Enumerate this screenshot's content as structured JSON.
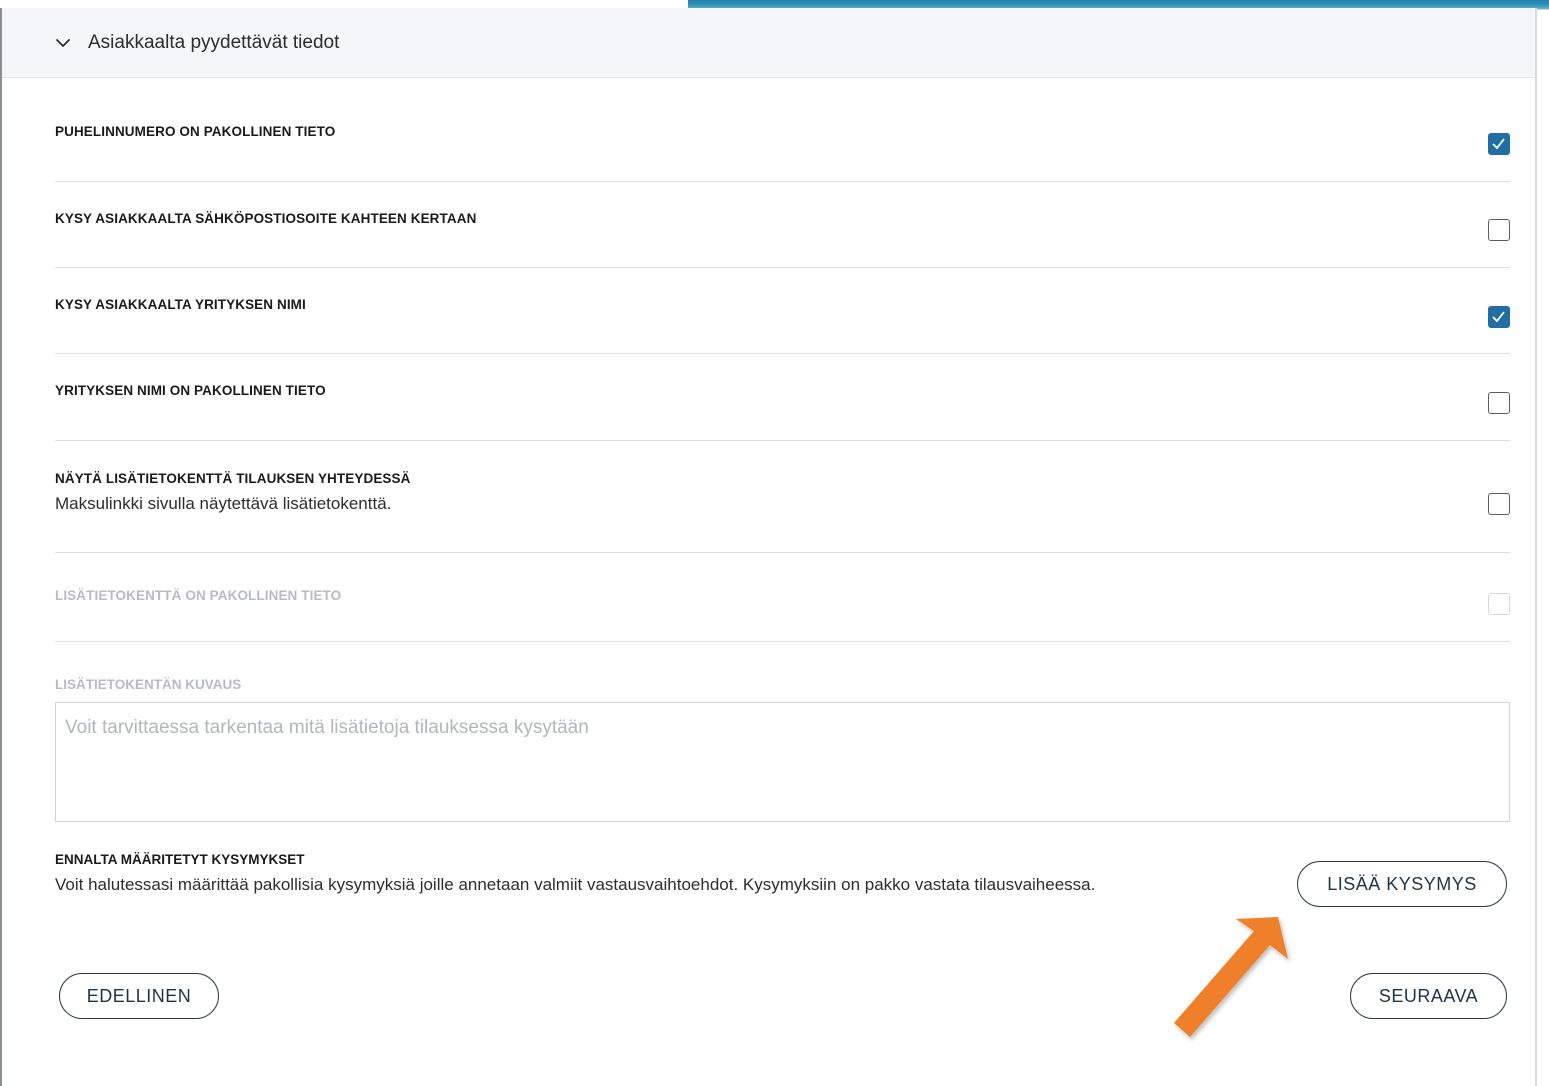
{
  "section": {
    "title": "Asiakkaalta pyydettävät tiedot"
  },
  "settings": [
    {
      "label": "PUHELINNUMERO ON PAKOLLINEN TIETO",
      "description": "",
      "checked": true,
      "disabled": false
    },
    {
      "label": "KYSY ASIAKKAALTA SÄHKÖPOSTIOSOITE KAHTEEN KERTAAN",
      "description": "",
      "checked": false,
      "disabled": false
    },
    {
      "label": "KYSY ASIAKKAALTA YRITYKSEN NIMI",
      "description": "",
      "checked": true,
      "disabled": false
    },
    {
      "label": "YRITYKSEN NIMI ON PAKOLLINEN TIETO",
      "description": "",
      "checked": false,
      "disabled": false
    },
    {
      "label": "NÄYTÄ LISÄTIETOKENTTÄ TILAUKSEN YHTEYDESSÄ",
      "description": "Maksulinkki sivulla näytettävä lisätietokenttä.",
      "checked": false,
      "disabled": false
    },
    {
      "label": "LISÄTIETOKENTTÄ ON PAKOLLINEN TIETO",
      "description": "",
      "checked": false,
      "disabled": true
    }
  ],
  "extra_field": {
    "label": "LISÄTIETOKENTÄN KUVAUS",
    "value": "",
    "placeholder": "Voit tarvittaessa tarkentaa mitä lisätietoja tilauksessa kysytään"
  },
  "predefined_questions": {
    "title": "ENNALTA MÄÄRITETYT KYSYMYKSET",
    "description": "Voit halutessasi määrittää pakollisia kysymyksiä joille annetaan valmiit vastausvaihtoehdot. Kysymyksiin on pakko vastata tilausvaiheessa.",
    "add_label": "LISÄÄ KYSYMYS"
  },
  "nav": {
    "previous_label": "EDELLINEN",
    "next_label": "SEURAAVA"
  },
  "colors": {
    "accent": "#1f6fa5",
    "arrow": "#f07f2a"
  },
  "icons": {
    "header": "chevron-down-icon",
    "checkbox": "checkmark-icon",
    "annotation": "arrow-icon"
  }
}
